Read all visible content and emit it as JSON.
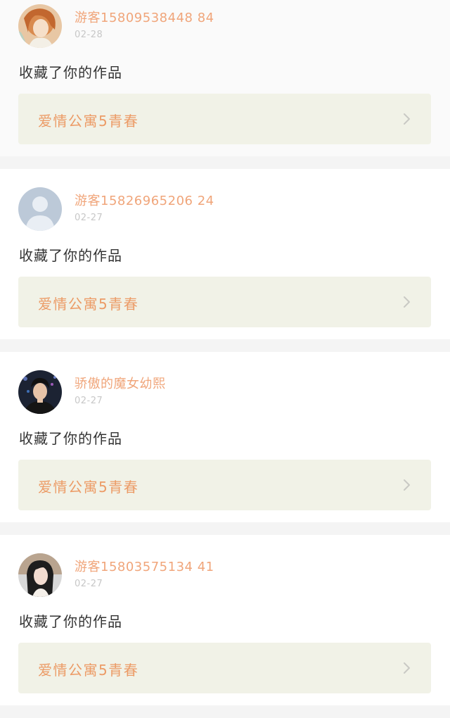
{
  "notifications": [
    {
      "username": "游客15809538448 84",
      "date": "02-28",
      "message": "收藏了你的作品",
      "work_title": "爱情公寓5青春",
      "avatar_icon": "anime-girl-avatar-icon"
    },
    {
      "username": "游客15826965206 24",
      "date": "02-27",
      "message": "收藏了你的作品",
      "work_title": "爱情公寓5青春",
      "avatar_icon": "default-user-avatar-icon"
    },
    {
      "username": "骄傲的魔女幼熙",
      "date": "02-27",
      "message": "收藏了你的作品",
      "work_title": "爱情公寓5青春",
      "avatar_icon": "boy-photo-avatar-icon"
    },
    {
      "username": "游客15803575134 41",
      "date": "02-27",
      "message": "收藏了你的作品",
      "work_title": "爱情公寓5青春",
      "avatar_icon": "girl-photo-avatar-icon"
    }
  ],
  "colors": {
    "username": "#f0a57a",
    "work_title": "#ec9b66",
    "work_link_bg": "#f1f2e7",
    "date": "#c7c7c7",
    "separator": "#f4f4f4"
  }
}
